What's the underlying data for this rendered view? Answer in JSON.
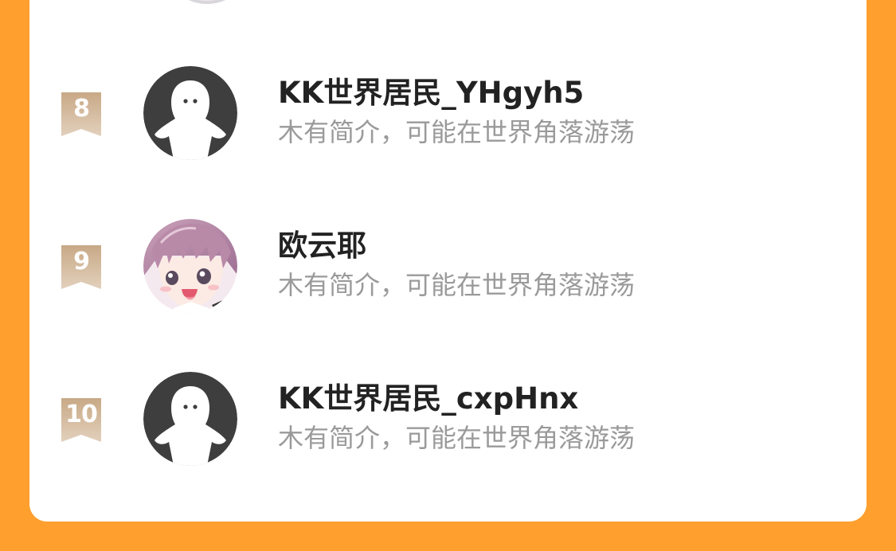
{
  "users": [
    {
      "rank": "8",
      "name": "KK世界居民_YHgyh5",
      "bio": "木有简介，可能在世界角落游荡",
      "avatar": "default-ghost-avatar"
    },
    {
      "rank": "9",
      "name": "欧云耶",
      "bio": "木有简介，可能在世界角落游荡",
      "avatar": "anime-girl-avatar"
    },
    {
      "rank": "10",
      "name": "KK世界居民_cxpHnx",
      "bio": "木有简介，可能在世界角落游荡",
      "avatar": "default-ghost-avatar"
    }
  ],
  "colors": {
    "background": "#FF9F2E",
    "card": "#FFFFFF",
    "badge_top": "#C8A986",
    "badge_bottom": "#E2D0BC",
    "name": "#222222",
    "bio": "#9A9A9A",
    "default_avatar_bg": "#3E3E3E"
  }
}
